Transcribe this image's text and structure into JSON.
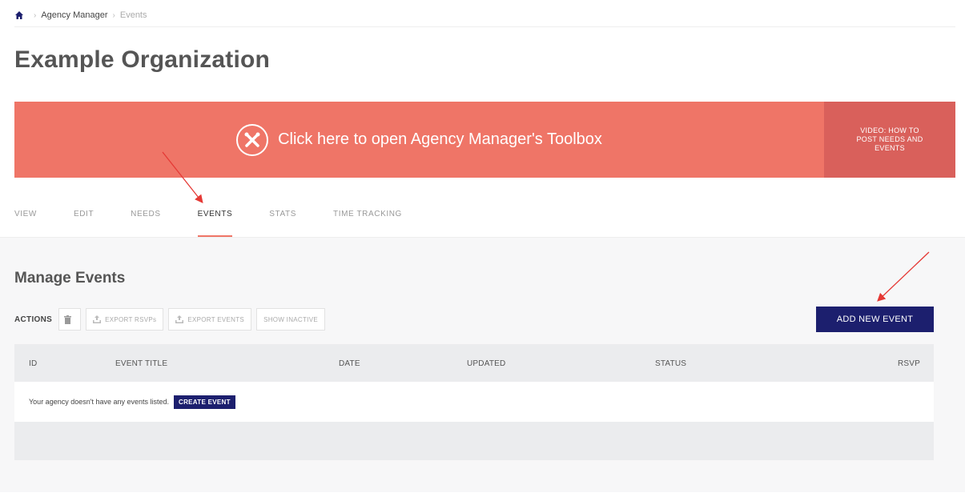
{
  "breadcrumb": {
    "home_icon": "home-icon",
    "agency_manager": "Agency Manager",
    "current": "Events"
  },
  "org": {
    "title": "Example Organization"
  },
  "toolbox": {
    "icon": "tools-icon",
    "text": "Click here to open Agency Manager's Toolbox",
    "video_label": "VIDEO: HOW TO POST NEEDS AND EVENTS",
    "banner_color": "#ef7567",
    "video_color": "#d9605b"
  },
  "tabs": [
    {
      "label": "VIEW",
      "active": false
    },
    {
      "label": "EDIT",
      "active": false
    },
    {
      "label": "NEEDS",
      "active": false
    },
    {
      "label": "EVENTS",
      "active": true
    },
    {
      "label": "STATS",
      "active": false
    },
    {
      "label": "TIME TRACKING",
      "active": false
    }
  ],
  "manage": {
    "title": "Manage Events",
    "actions_label": "ACTIONS",
    "trash_icon": "trash-icon",
    "export_rsvps": "EXPORT RSVPs",
    "export_events": "EXPORT EVENTS",
    "show_inactive": "SHOW INACTIVE",
    "add_new_event": "ADD NEW EVENT",
    "button_color": "#1c1f6e"
  },
  "table": {
    "columns": [
      "ID",
      "EVENT TITLE",
      "DATE",
      "UPDATED",
      "STATUS",
      "RSVP"
    ],
    "empty_message": "Your agency doesn't have any events listed.",
    "create_event": "CREATE EVENT"
  },
  "annotation_color": "#e53935"
}
